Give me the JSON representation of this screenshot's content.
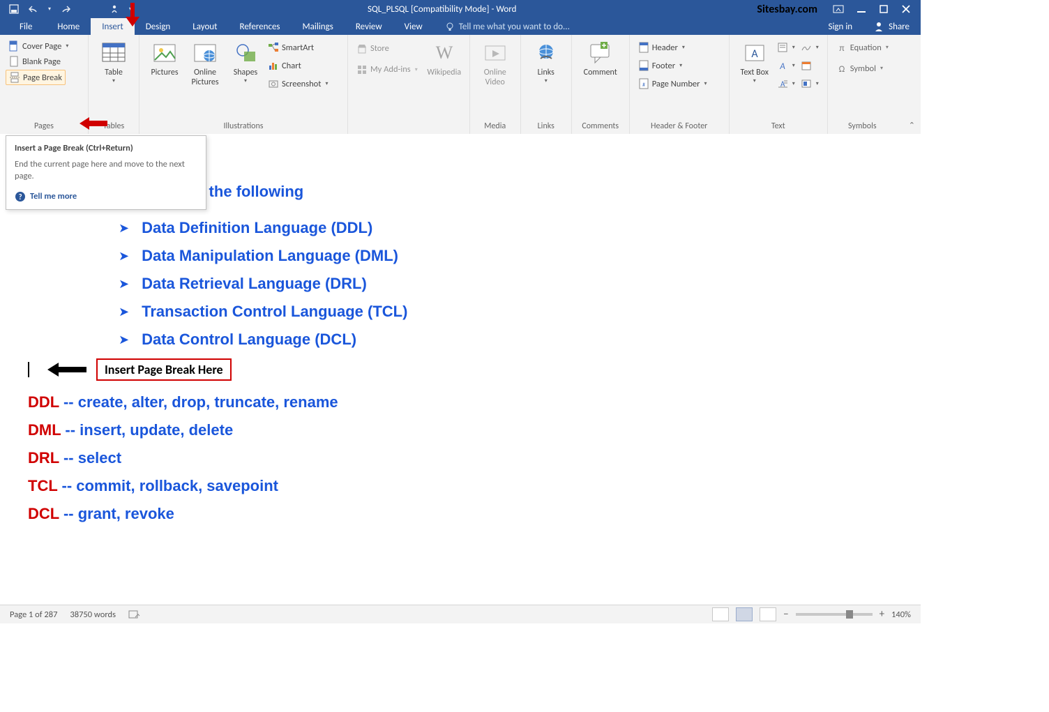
{
  "title": "SQL_PLSQL [Compatibility Mode] - Word",
  "watermark": "Sitesbay.com",
  "tabs": {
    "file": "File",
    "home": "Home",
    "insert": "Insert",
    "design": "Design",
    "layout": "Layout",
    "references": "References",
    "mailings": "Mailings",
    "review": "Review",
    "view": "View",
    "tellme": "Tell me what you want to do...",
    "signin": "Sign in",
    "share": "Share"
  },
  "ribbon": {
    "pages": {
      "cover": "Cover Page",
      "blank": "Blank Page",
      "break": "Page Break",
      "group": "Pages"
    },
    "tables": {
      "table": "Table",
      "group": "Tables"
    },
    "illus": {
      "pictures": "Pictures",
      "online": "Online Pictures",
      "shapes": "Shapes",
      "smartart": "SmartArt",
      "chart": "Chart",
      "screenshot": "Screenshot",
      "group": "Illustrations"
    },
    "addins": {
      "store": "Store",
      "my": "My Add-ins",
      "wiki": "Wikipedia"
    },
    "media": {
      "online": "Online Video",
      "group": "Media"
    },
    "links": {
      "links": "Links",
      "group": "Links"
    },
    "comments": {
      "comment": "Comment",
      "group": "Comments"
    },
    "hf": {
      "header": "Header",
      "footer": "Footer",
      "pagenum": "Page Number",
      "group": "Header & Footer"
    },
    "text": {
      "textbox": "Text Box",
      "group": "Text"
    },
    "symbols": {
      "equation": "Equation",
      "symbol": "Symbol",
      "group": "Symbols"
    }
  },
  "tooltip": {
    "title": "Insert a Page Break (Ctrl+Return)",
    "body": "End the current page here and move to the next page.",
    "more": "Tell me more"
  },
  "doc": {
    "heading": "o the following",
    "bullets": [
      "Data Definition Language (DDL)",
      "Data Manipulation Language (DML)",
      "Data Retrieval Language (DRL)",
      "Transaction Control Language (TCL)",
      "Data Control Language (DCL)"
    ],
    "annot": "Insert Page Break Here",
    "defs": [
      {
        "term": "DDL",
        "rest": " -- create, alter, drop, truncate, rename"
      },
      {
        "term": "DML",
        "rest": " -- insert, update, delete"
      },
      {
        "term": "DRL",
        "rest": " -- select"
      },
      {
        "term": "TCL",
        "rest": " -- commit, rollback, savepoint"
      },
      {
        "term": "DCL",
        "rest": " -- grant, revoke"
      }
    ]
  },
  "status": {
    "page": "Page 1 of 287",
    "words": "38750 words",
    "zoom": "140%"
  }
}
